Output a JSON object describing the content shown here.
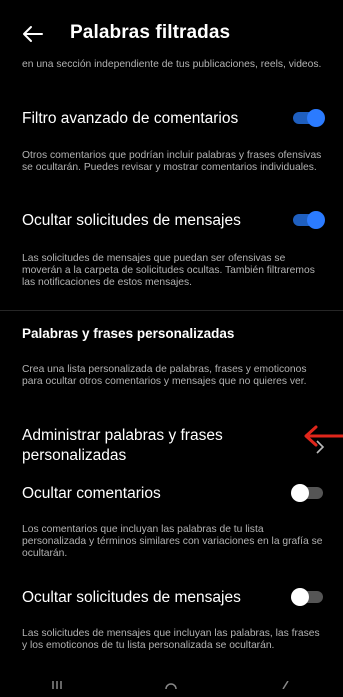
{
  "header": {
    "title": "Palabras filtradas"
  },
  "intro_tail": "en una sección independiente de tus publicaciones, reels, videos.",
  "settings": {
    "advanced_filter": {
      "label": "Filtro avanzado de comentarios",
      "description": "Otros comentarios que podrían incluir palabras y frases ofensivas se ocultarán. Puedes revisar y mostrar comentarios individuales.",
      "enabled": true
    },
    "hide_message_requests": {
      "label": "Ocultar solicitudes de mensajes",
      "description": "Las solicitudes de mensajes que puedan ser ofensivas se moverán a la carpeta de solicitudes ocultas. También filtraremos las notificaciones de estos mensajes.",
      "enabled": true
    }
  },
  "custom_section": {
    "title": "Palabras y frases personalizadas",
    "description": "Crea una lista personalizada de palabras, frases y emoticonos para ocultar otros comentarios y mensajes que no quieres ver.",
    "manage_label": "Administrar palabras y frases personalizadas",
    "hide_comments": {
      "label": "Ocultar comentarios",
      "description": "Los comentarios que incluyan las palabras de tu lista personalizada y términos similares con variaciones en la grafía se ocultarán.",
      "enabled": false
    },
    "hide_custom_message_requests": {
      "label": "Ocultar solicitudes de mensajes",
      "description": "Las solicitudes de mensajes que incluyan las palabras, las frases y los emoticonos de tu lista personalizada se ocultarán.",
      "enabled": false
    }
  },
  "colors": {
    "toggle_on": "#2b7bff",
    "annotation_arrow": "#e0261b"
  },
  "icons": {
    "back": "arrow-left-icon",
    "chevron": "chevron-right-icon",
    "annotation": "red-arrow-icon"
  }
}
